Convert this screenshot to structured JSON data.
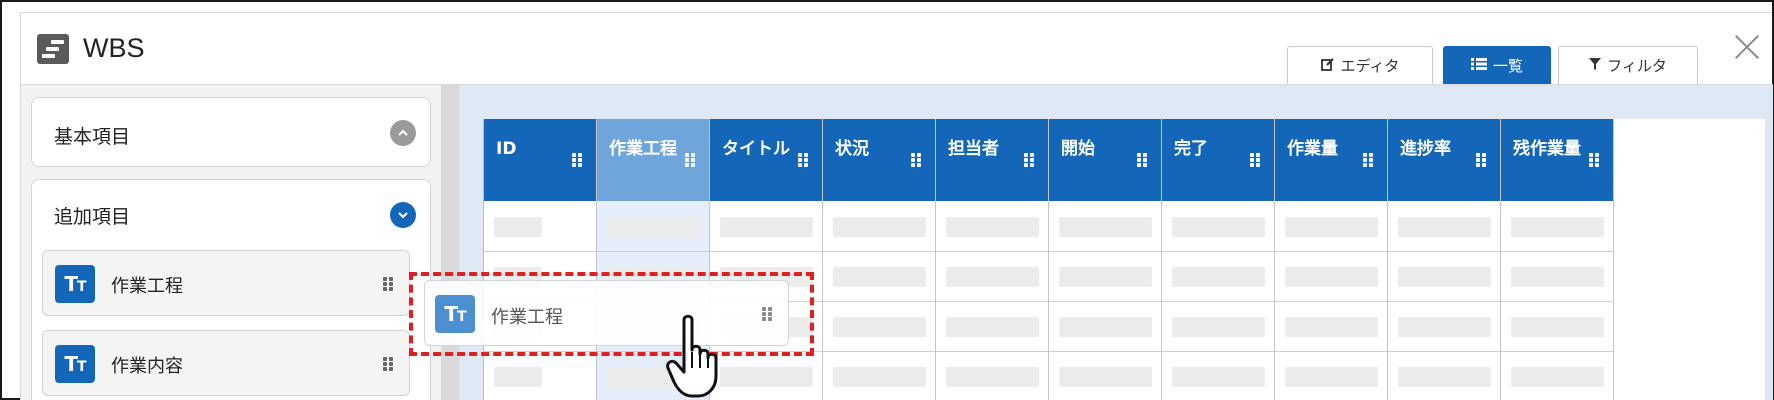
{
  "window": {
    "title": "WBS",
    "icon": "list-logo-icon"
  },
  "tabs": [
    {
      "label": "エディタ",
      "icon": "edit-icon",
      "active": false
    },
    {
      "label": "一覧",
      "icon": "list-icon",
      "active": true
    },
    {
      "label": "フィルタ",
      "icon": "filter-icon",
      "active": false
    }
  ],
  "sidebar": {
    "sections": [
      {
        "label": "基本項目",
        "expanded": false
      },
      {
        "label": "追加項目",
        "expanded": true
      }
    ],
    "fields": [
      {
        "label": "作業工程",
        "icon": "text-type-icon"
      },
      {
        "label": "作業内容",
        "icon": "text-type-icon"
      }
    ]
  },
  "table": {
    "columns": [
      "ID",
      "作業工程",
      "タイトル",
      "状況",
      "担当者",
      "開始",
      "完了",
      "作業量",
      "進捗率",
      "残作業量"
    ],
    "highlighted_column": "作業工程"
  },
  "drag": {
    "ghost_label": "作業工程",
    "icon": "text-type-icon"
  },
  "colors": {
    "accent": "#1366b8",
    "header_highlight": "#6fa5da",
    "drop_outline": "#e02020",
    "panel_bg": "#dfe9f5"
  },
  "tt_glyph": {
    "big": "T",
    "small": "T"
  }
}
